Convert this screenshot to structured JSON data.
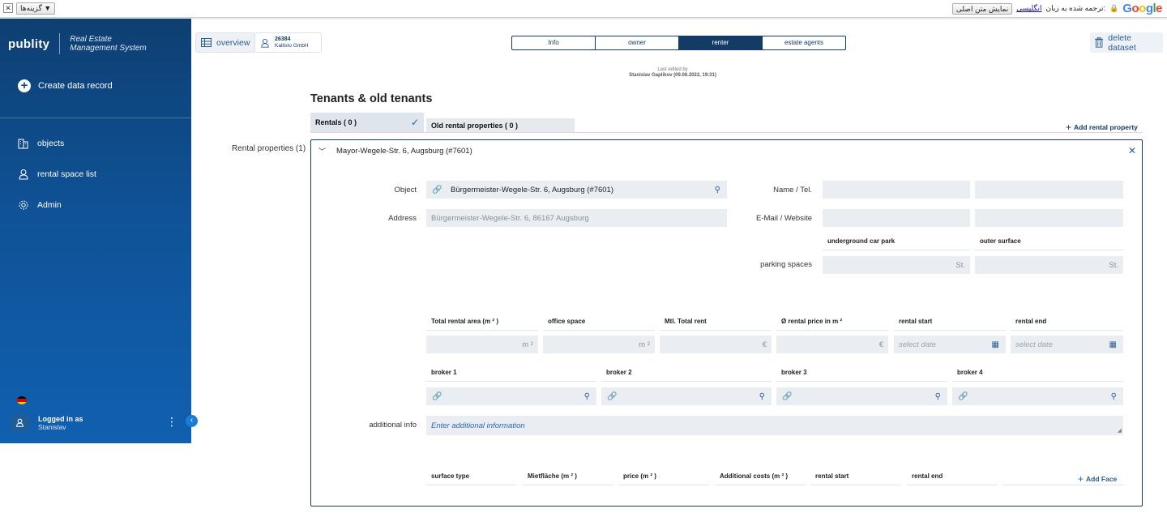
{
  "google_bar": {
    "options_label": "گزینه‌ها ▼",
    "translated_text": "ترجمه شده به زبان:",
    "language": "انگلیسی",
    "show_original": "نمایش متن اصلی",
    "brand": "Google"
  },
  "sidebar": {
    "logo": "publity",
    "subtitle_1": "Real Estate",
    "subtitle_2": "Management System",
    "create_label": "Create data record",
    "nav": [
      {
        "label": "objects",
        "icon": "building-icon"
      },
      {
        "label": "rental space list",
        "icon": "person-icon"
      },
      {
        "label": "Admin",
        "icon": "gear-icon"
      }
    ],
    "user_line1": "Logged in as",
    "user_line2": "Stanislav"
  },
  "topbar": {
    "overview_label": "overview",
    "record_number": "26384",
    "record_company": "Kallisto GmbH",
    "tabs": [
      "Info",
      "owner",
      "renter",
      "estate agents"
    ],
    "active_tab": "renter",
    "delete_label": "delete dataset",
    "last_edited_label": "Last edited by",
    "last_edited_value": "Stanislav Gaplikov (09.06.2022, 19:31)"
  },
  "section": {
    "title": "Tenants & old tenants",
    "tab_rentals": "Rentals ( 0 )",
    "tab_old": "Old rental properties ( 0 )",
    "add_rental": "Add rental property",
    "rental_properties_label": "Rental properties (1)"
  },
  "card": {
    "title": "Mayor-Wegele-Str. 6, Augsburg (#7601)",
    "object_label": "Object",
    "object_value": "Bürgermeister-Wegele-Str. 6, Augsburg (#7601)",
    "address_label": "Address",
    "address_value": "Bürgermeister-Wegele-Str. 6, 86167 Augsburg",
    "name_tel_label": "Name / Tel.",
    "email_label": "E-Mail / Website",
    "underground_label": "underground car park",
    "outer_label": "outer surface",
    "parking_label": "parking spaces",
    "parking_unit": "St.",
    "cols": [
      "Total rental area (m ² )",
      "office space",
      "Mtl. Total rent",
      "Ø rental price in m ²",
      "rental start",
      "rental end"
    ],
    "unit_m2": "m ²",
    "unit_eur": "€",
    "date_placeholder": "select date",
    "brokers": [
      "broker 1",
      "broker 2",
      "broker 3",
      "broker 4"
    ],
    "additional_label": "additional info",
    "additional_placeholder": "Enter additional information",
    "surface_cols": [
      "surface type",
      "Mietfläche (m ² )",
      "price (m ² )",
      "Additional costs (m ² )",
      "rental start",
      "rental end"
    ],
    "add_face": "Add Face"
  }
}
